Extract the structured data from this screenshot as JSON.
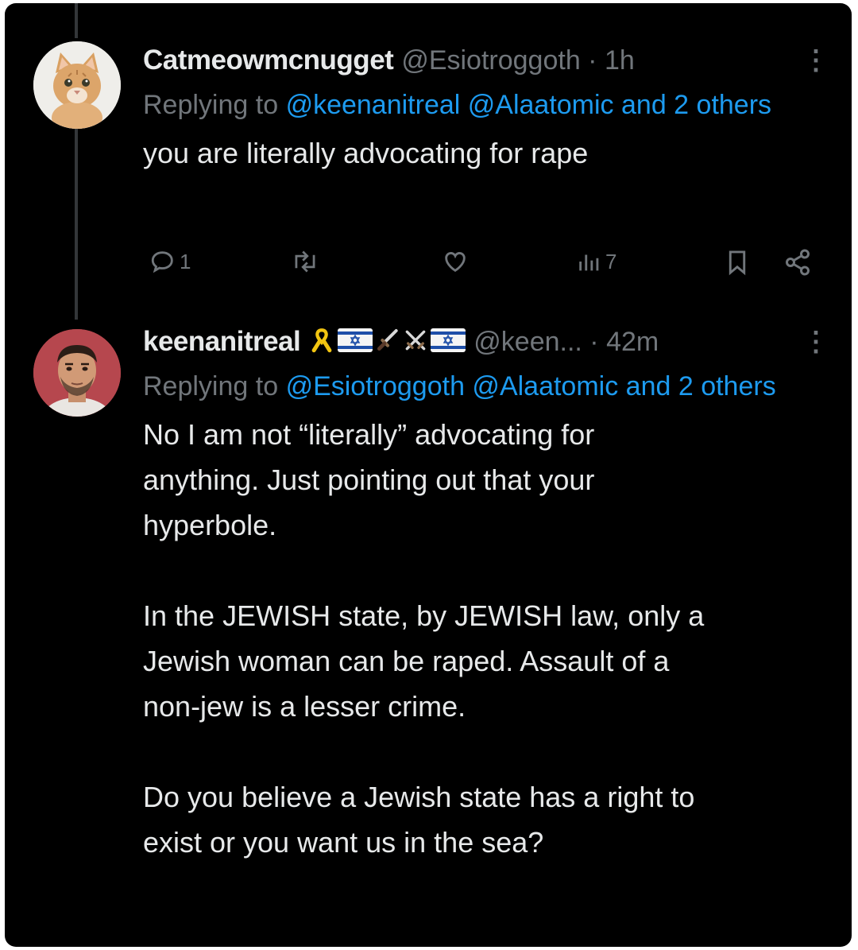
{
  "tweets": [
    {
      "display_name": "Catmeowmcnugget",
      "handle_time": "@Esiotroggoth · 1h",
      "replying_prefix": "Replying to",
      "replying_mentions": "@keenanitreal @Alaatomic and 2 others",
      "text": "you are literally advocating for rape",
      "avatar": "cat-avatar",
      "actions": {
        "reply_count": "1",
        "views_count": "7"
      }
    },
    {
      "display_name": "keenanitreal",
      "handle_time": "@keen... · 42m",
      "replying_prefix": "Replying to",
      "replying_mentions": "@Esiotroggoth @Alaatomic and 2 others",
      "text": "No I am not “literally” advocating for\nanything.  Just pointing out that your\nhyperbole.\n\nIn the JEWISH state, by JEWISH law, only a\nJewish woman can be raped.  Assault of a\nnon-jew is a lesser crime.\n\nDo you believe a Jewish state has a right to\nexist or you want us in the sea?",
      "avatar": "man-avatar",
      "name_emojis": [
        "yellow-ribbon-icon",
        "israel-flag-icon",
        "dagger-icon",
        "crossed-swords-icon",
        "israel-flag-icon"
      ]
    }
  ],
  "colors": {
    "background": "#000000",
    "text": "#e7e9ea",
    "muted": "#71767b",
    "mention": "#1d9bf0"
  }
}
